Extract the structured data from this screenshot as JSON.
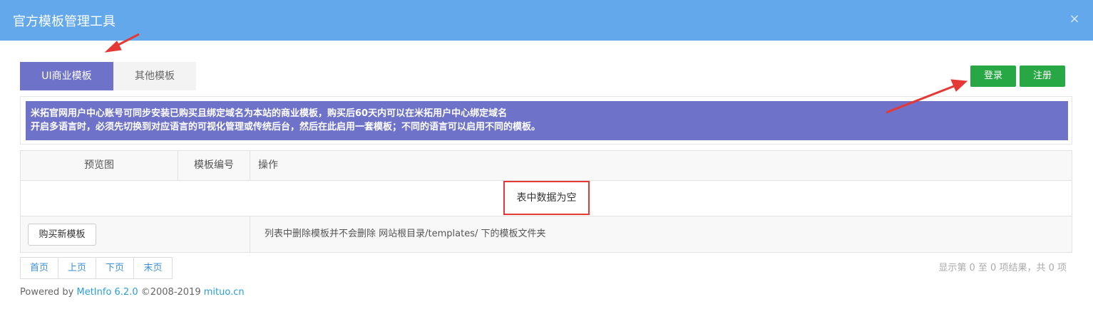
{
  "window": {
    "title": "官方模板管理工具",
    "close_glyph": "×"
  },
  "tabs": [
    {
      "label": "UI商业模板",
      "active": true
    },
    {
      "label": "其他模板",
      "active": false
    }
  ],
  "account": {
    "login_label": "登录",
    "register_label": "注册"
  },
  "notice": {
    "line1": "米拓官网用户中心账号可同步安装已购买且绑定域名为本站的商业模板，购买后60天内可以在米拓用户中心绑定域名",
    "line2": "开启多语言时，必须先切换到对应语言的可视化管理或传统后台，然后在此启用一套模板；不同的语言可以启用不同的模板。"
  },
  "table": {
    "headers": [
      "预览图",
      "模板编号",
      "操作"
    ],
    "empty_text": "表中数据为空",
    "buy_button": "购买新模板",
    "footer_note": "列表中删除模板并不会删除 网站根目录/templates/ 下的模板文件夹"
  },
  "pagination": {
    "first": "首页",
    "prev": "上页",
    "next": "下页",
    "last": "末页",
    "info": "显示第 0 至 0 项结果，共 0 项"
  },
  "footer": {
    "powered_by": "Powered by ",
    "product": "MetInfo 6.2.0",
    "copyright": " ©2008-2019 ",
    "site": "mituo.cn"
  },
  "colors": {
    "header": "#62a8ea",
    "accent": "#6e72c9",
    "green": "#28a745",
    "highlight": "#e53935",
    "annotation_arrow": "#e53935"
  }
}
